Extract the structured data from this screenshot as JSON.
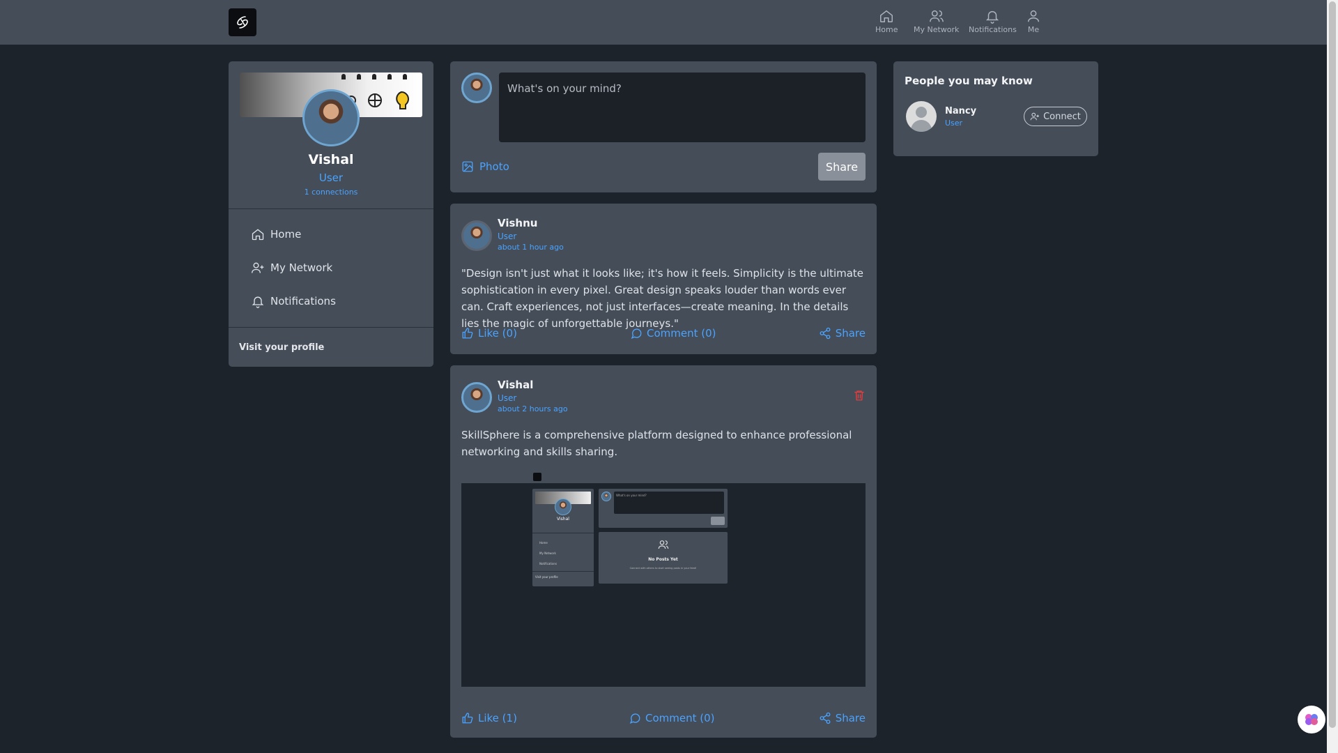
{
  "topnav": {
    "home": "Home",
    "network": "My Network",
    "notifications": "Notifications",
    "me": "Me"
  },
  "profile": {
    "name": "Vishal",
    "role": "User",
    "connections": "1 connections"
  },
  "sidebar": {
    "items": [
      {
        "label": "Home",
        "icon": "home-icon"
      },
      {
        "label": "My Network",
        "icon": "user-plus-icon"
      },
      {
        "label": "Notifications",
        "icon": "bell-icon"
      }
    ],
    "visit_profile": "Visit your profile"
  },
  "composer": {
    "placeholder": "What's on your mind?",
    "photo_label": "Photo",
    "share_label": "Share"
  },
  "posts": [
    {
      "author": "Vishnu",
      "role": "User",
      "time": "about 1 hour ago",
      "text": "\"Design isn't just what it looks like; it's how it feels. Simplicity is the ultimate sophistication in every pixel. Great design speaks louder than words ever can. Craft experiences, not just interfaces—create meaning. In the details lies the magic of unforgettable journeys.\"",
      "like": "Like (0)",
      "comment": "Comment (0)",
      "share": "Share"
    },
    {
      "author": "Vishal",
      "role": "User",
      "time": "about 2 hours ago",
      "text": "SkillSphere is a comprehensive platform designed to enhance professional networking and skills sharing.",
      "like": "Like (1)",
      "comment": "Comment (0)",
      "share": "Share",
      "image": {
        "mini_name": "Vishal",
        "mini_placeholder": "What's on your mind?",
        "mini_nav": [
          "Home",
          "My Network",
          "Notifications"
        ],
        "mini_visit": "Visit your profile",
        "no_posts_title": "No Posts Yet",
        "no_posts_text": "Connect with others to start seeing posts in your feed!"
      }
    }
  ],
  "suggestions": {
    "title": "People you may know",
    "users": [
      {
        "name": "Nancy",
        "role": "User",
        "action": "Connect"
      }
    ]
  },
  "colors": {
    "accent": "#4aa3ff",
    "card": "#454d59",
    "background": "#1d232b",
    "danger": "#e53e3e"
  }
}
